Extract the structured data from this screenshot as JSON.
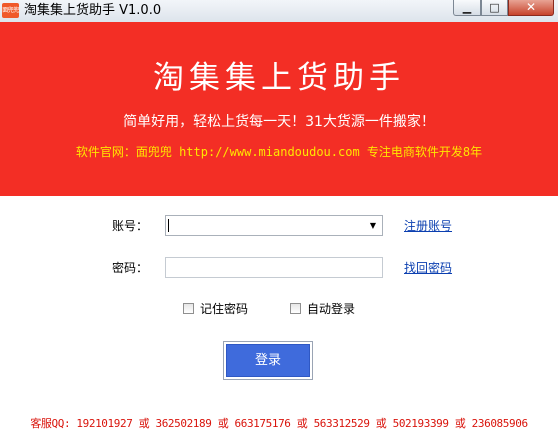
{
  "window": {
    "title": "淘集集上货助手 V1.0.0",
    "icon_text": "面兜兜",
    "controls": {
      "minimize_icon": "minimize-icon",
      "maximize_icon": "maximize-icon",
      "close_icon": "close-icon"
    }
  },
  "banner": {
    "title": "淘集集上货助手",
    "slogan": "简单好用，轻松上货每一天！31大货源一件搬家！",
    "site": "软件官网：面兜兜 http://www.miandoudou.com 专注电商软件开发8年",
    "background": "#f32e25",
    "site_color": "#ffe600"
  },
  "form": {
    "account_label": "账号：",
    "account_value": "",
    "password_label": "密码：",
    "password_value": "",
    "register_link": "注册账号",
    "recover_link": "找回密码",
    "remember_password": {
      "label": "记住密码",
      "checked": false
    },
    "auto_login": {
      "label": "自动登录",
      "checked": false
    },
    "login_button": "登录"
  },
  "footer": {
    "support_text": "客服QQ: 192101927 或 362502189 或 663175176 或 563312529 或 502193399 或 236085906",
    "color": "#d9140c"
  },
  "colors": {
    "accent": "#3f6bdc",
    "link": "#0b3fb0"
  }
}
